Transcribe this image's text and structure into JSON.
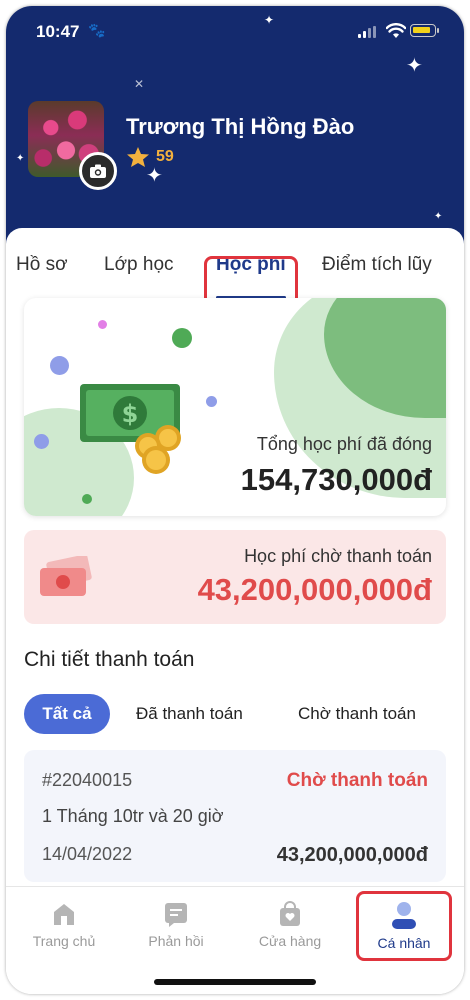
{
  "status_bar": {
    "time": "10:47"
  },
  "profile": {
    "name": "Trương Thị Hồng Đào",
    "points": "59"
  },
  "tabs": [
    {
      "label": "Hồ sơ"
    },
    {
      "label": "Lớp học"
    },
    {
      "label": "Học phí"
    },
    {
      "label": "Điểm tích lũy"
    }
  ],
  "active_tab": "Học phí",
  "summary": {
    "total_paid_label": "Tổng học phí đã đóng",
    "total_paid_value": "154,730,000đ"
  },
  "pending": {
    "label": "Học phí chờ thanh toán",
    "value": "43,200,000,000đ"
  },
  "payment_details": {
    "title": "Chi tiết thanh toán",
    "filters": [
      {
        "label": "Tất cả"
      },
      {
        "label": "Đã thanh toán"
      },
      {
        "label": "Chờ thanh toán"
      }
    ],
    "items": [
      {
        "id": "#22040015",
        "status": "Chờ thanh toán",
        "description": "1 Tháng 10tr và 20 giờ",
        "date": "14/04/2022",
        "amount": "43,200,000,000đ"
      }
    ]
  },
  "bottom_nav": [
    {
      "label": "Trang chủ",
      "icon": "home-icon"
    },
    {
      "label": "Phản hồi",
      "icon": "feedback-icon"
    },
    {
      "label": "Cửa hàng",
      "icon": "shop-icon"
    },
    {
      "label": "Cá nhân",
      "icon": "person-icon"
    }
  ],
  "colors": {
    "header_bg": "#142a6e",
    "accent_blue": "#1f3a8a",
    "filter_active": "#4b6bd6",
    "pending_red": "#e04b4b",
    "pending_bg": "#fbe7e7",
    "points_gold": "#f3b13e",
    "highlight_red": "#e0343d"
  }
}
